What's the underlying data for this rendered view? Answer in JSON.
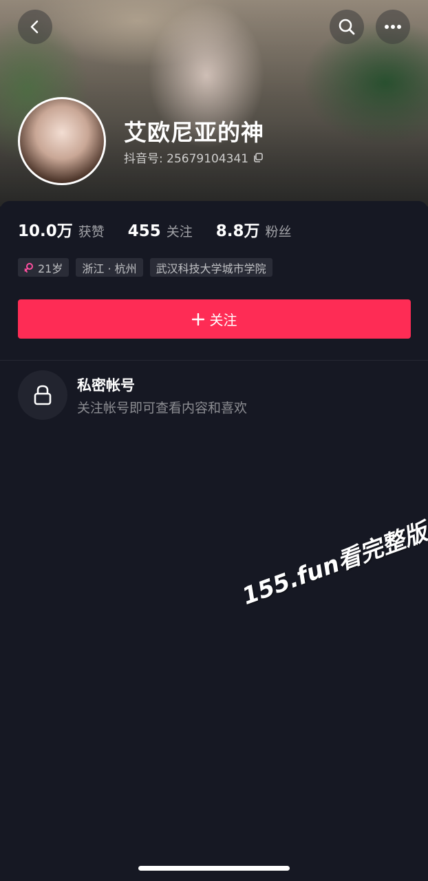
{
  "profile": {
    "nickname": "艾欧尼亚的神",
    "douyin_id_label": "抖音号: 25679104341"
  },
  "stats": [
    {
      "value": "10.0万",
      "label": "获赞"
    },
    {
      "value": "455",
      "label": "关注"
    },
    {
      "value": "8.8万",
      "label": "粉丝"
    }
  ],
  "tags": {
    "age": "21岁",
    "location": "浙江 · 杭州",
    "school": "武汉科技大学城市学院"
  },
  "follow_button": {
    "icon": "plus-icon",
    "label": "关注"
  },
  "private_notice": {
    "icon": "lock-icon",
    "title": "私密帐号",
    "description": "关注帐号即可查看内容和喜欢"
  },
  "watermark": "155.fun看完整版",
  "colors": {
    "background": "#161823",
    "accent": "#fe2c55",
    "female_icon": "#ff4fa0"
  }
}
